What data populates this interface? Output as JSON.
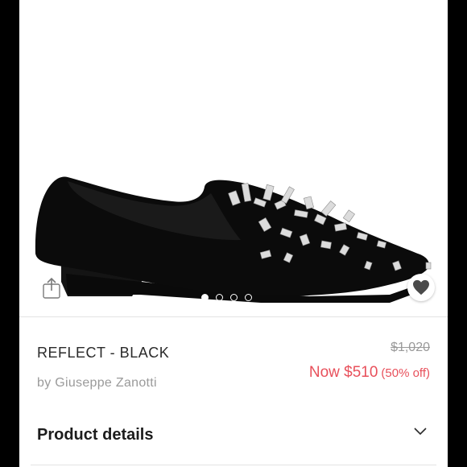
{
  "product": {
    "title": "REFLECT - BLACK",
    "brand_line": "by Giuseppe Zanotti",
    "original_price": "$1,020",
    "sale_price": "Now $510",
    "discount": "(50% off)"
  },
  "details": {
    "label": "Product details"
  },
  "gallery": {
    "image_count": 4,
    "active_index": 0
  },
  "icons": {
    "share": "share-icon",
    "favorite": "heart-icon",
    "expand": "chevron-down-icon"
  },
  "colors": {
    "sale_red": "#e8505b",
    "muted_gray": "#9a9a9a",
    "text_dark": "#2a2a2a"
  }
}
